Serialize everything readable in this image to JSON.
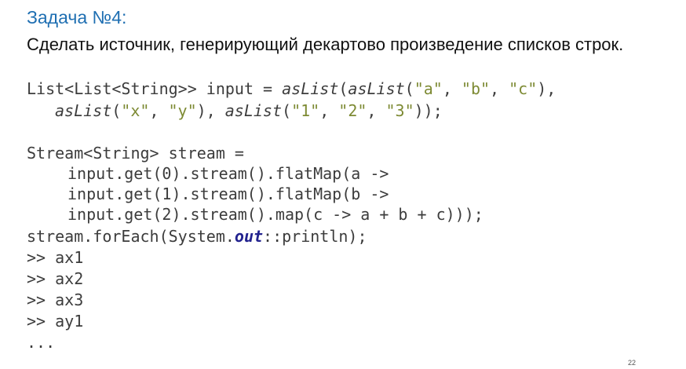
{
  "slide": {
    "title": "Задача №4:",
    "subtitle": "Сделать источник, генерирующий декартово произведение списков строк.",
    "page_number": "22"
  },
  "code": {
    "l1": {
      "a": "List<List<String>> input = ",
      "b": "asList",
      "c": "(",
      "d": "asList",
      "e": "(",
      "s1": "\"a\"",
      "f": ", ",
      "s2": "\"b\"",
      "g": ", ",
      "s3": "\"c\"",
      "h": "),"
    },
    "l2": {
      "a": "asList",
      "b": "(",
      "s1": "\"x\"",
      "c": ", ",
      "s2": "\"y\"",
      "d": "), ",
      "e": "asList",
      "f": "(",
      "s3": "\"1\"",
      "g": ", ",
      "s4": "\"2\"",
      "h": ", ",
      "s5": "\"3\"",
      "i": "));"
    },
    "l3": "Stream<String> stream =",
    "l4": "input.get(0).stream().flatMap(a ->",
    "l5": "input.get(1).stream().flatMap(b ->",
    "l6": "input.get(2).stream().map(c -> a + b + c)));",
    "l7": {
      "a": "stream.forEach(System.",
      "b": "out",
      "c": "::println);"
    },
    "out1": ">> ax1",
    "out2": ">> ax2",
    "out3": ">> ax3",
    "out4": ">> ay1",
    "ellipsis": "..."
  }
}
